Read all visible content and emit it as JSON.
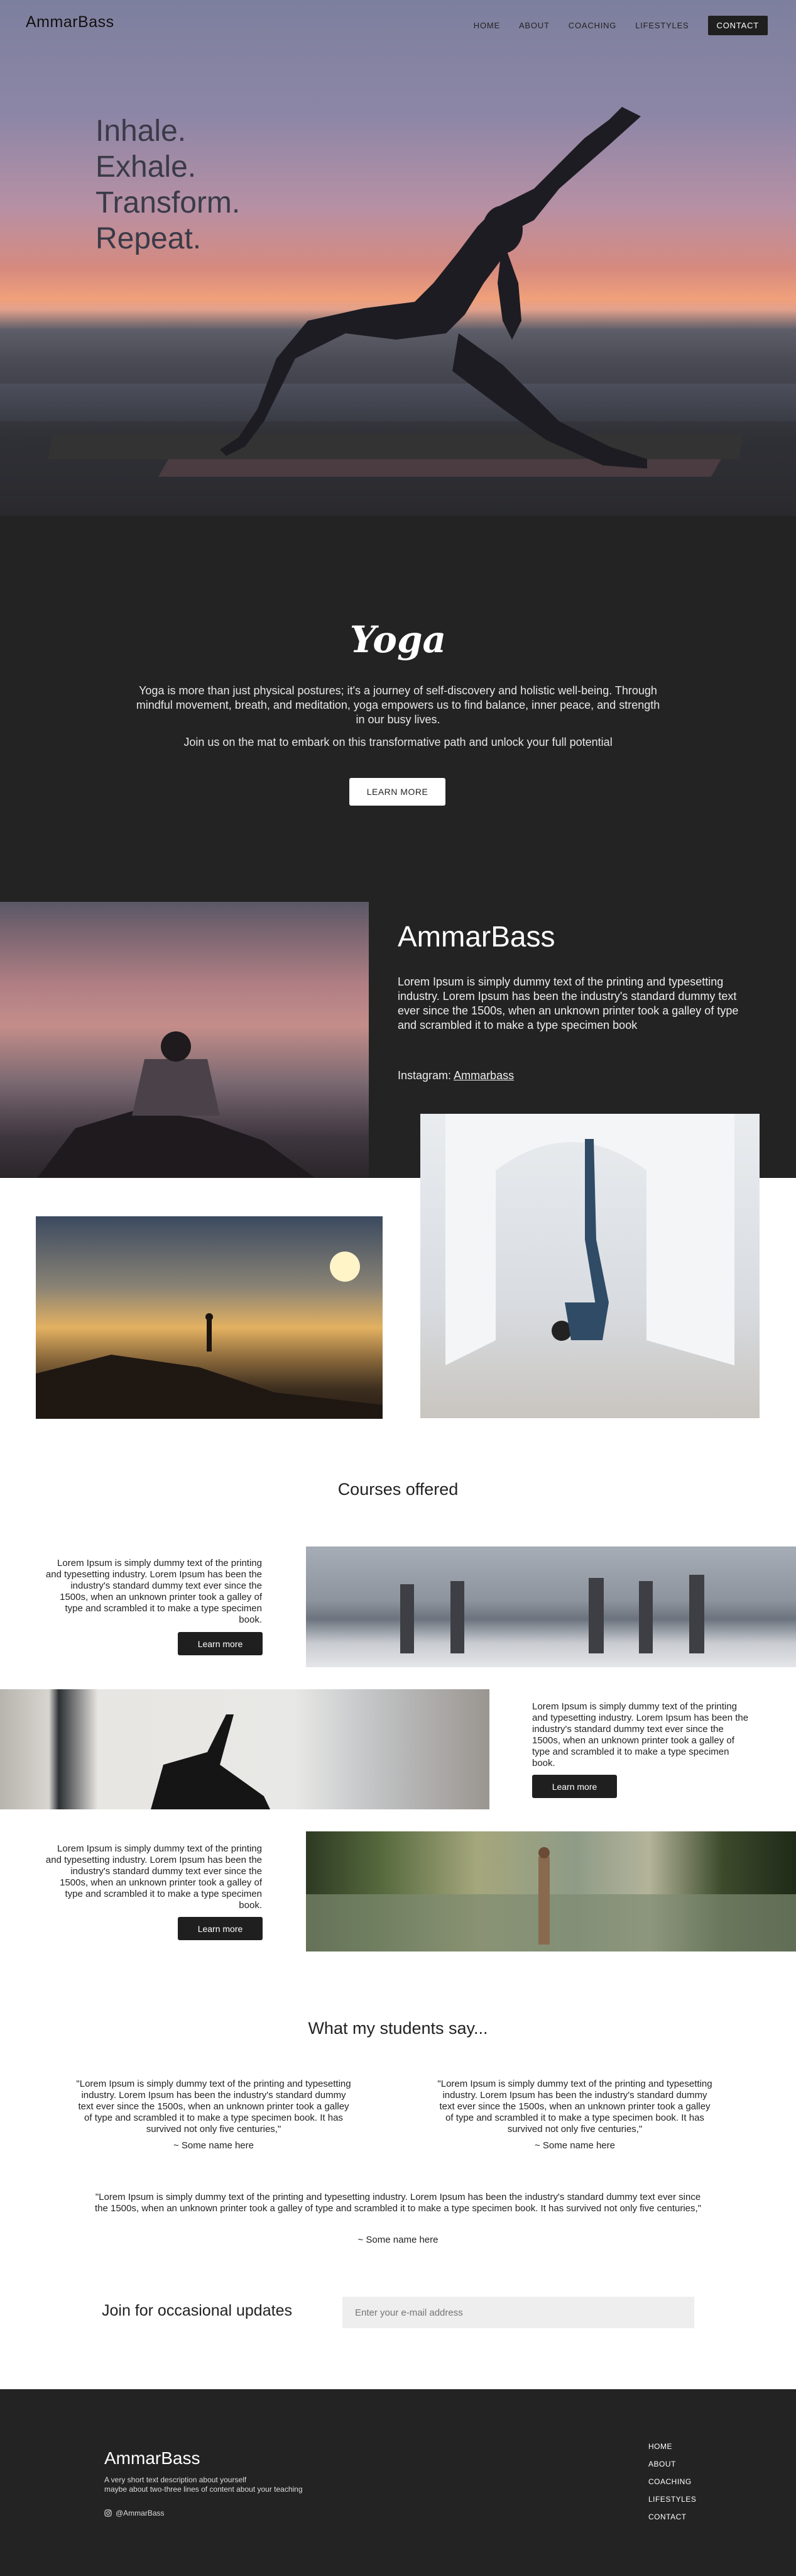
{
  "header": {
    "brand": "AmmarBass",
    "nav": [
      "HOME",
      "ABOUT",
      "COACHING",
      "LIFESTYLES"
    ],
    "contact": "CONTACT"
  },
  "hero": {
    "lines": [
      "Inhale.",
      "Exhale.",
      "Transform.",
      "Repeat."
    ]
  },
  "yoga": {
    "title": "Yoga",
    "paragraph": "Yoga is more than just physical postures; it's a journey of self-discovery and holistic well-being. Through mindful movement, breath, and meditation, yoga empowers us to find balance, inner peace, and strength in our busy lives.",
    "paragraph2": "Join us on the mat to embark on this transformative path and unlock your full potential",
    "button": "LEARN MORE"
  },
  "about": {
    "title": "AmmarBass",
    "paragraph": "Lorem Ipsum is simply dummy text of the printing and typesetting industry. Lorem Ipsum has been the industry's standard dummy text ever since the 1500s, when an unknown printer took a galley of type and scrambled it to make a type specimen book",
    "instagram_label": "Instagram:",
    "instagram_handle": "Ammarbass"
  },
  "courses": {
    "title": "Courses offered",
    "items": [
      {
        "text": "Lorem Ipsum is simply dummy text of the printing and typesetting industry. Lorem Ipsum has been the industry's standard dummy text ever since the 1500s, when an unknown printer took a galley of type and scrambled it to make a type specimen book.",
        "button": "Learn more"
      },
      {
        "text": "Lorem Ipsum is simply dummy text of the printing and typesetting industry. Lorem Ipsum has been the industry's standard dummy text ever since the 1500s, when an unknown printer took a galley of type and scrambled it to make a type specimen book.",
        "button": "Learn more"
      },
      {
        "text": "Lorem Ipsum is simply dummy text of the printing and typesetting industry. Lorem Ipsum has been the industry's standard dummy text ever since the 1500s, when an unknown printer took a galley of type and scrambled it to make a type specimen book.",
        "button": "Learn more"
      }
    ]
  },
  "testimonials": {
    "title": "What my students say...",
    "items": [
      {
        "quote": "\"Lorem Ipsum is simply dummy text of the printing and typesetting industry. Lorem Ipsum has been the industry's standard dummy text ever since the 1500s, when an unknown printer took a galley of type and scrambled it to make a type specimen book. It has survived not only five centuries,\"",
        "author": "~ Some name here"
      },
      {
        "quote": "\"Lorem Ipsum is simply dummy text of the printing and typesetting industry. Lorem Ipsum has been the industry's standard dummy text ever since the 1500s, when an unknown printer took a galley of type and scrambled it to make a type specimen book. It has survived not only five centuries,\"",
        "author": "~ Some name here"
      },
      {
        "quote": "\"Lorem Ipsum is simply dummy text of the printing and typesetting industry. Lorem Ipsum has been the industry's standard dummy text ever since the 1500s, when an unknown printer took a galley of type and scrambled it to make a type specimen book. It has survived not only five centuries,\"",
        "author": "~ Some name here"
      }
    ]
  },
  "newsletter": {
    "title": "Join for occasional updates",
    "placeholder": "Enter your e-mail address"
  },
  "footer": {
    "brand": "AmmarBass",
    "desc_line1": "A very short text description about yourself",
    "desc_line2": "maybe about two-three lines of content about your teaching",
    "instagram": "@AmmarBass",
    "nav": [
      "HOME",
      "ABOUT",
      "COACHING",
      "LIFESTYLES",
      "CONTACT"
    ]
  },
  "colors": {
    "dark_bg": "#232323",
    "button_dark": "#1f1f1f"
  }
}
